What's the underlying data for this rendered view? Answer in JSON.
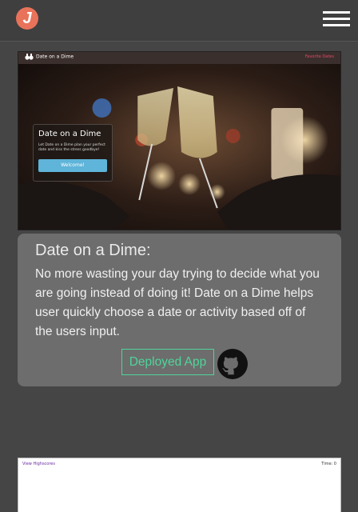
{
  "header": {
    "logo_letter": "J",
    "logo_color": "#e8735a"
  },
  "project": {
    "screenshot": {
      "nav_brand": "Date on a Dime",
      "nav_link": "Favorite Dates",
      "card_title": "Date on a Dime",
      "card_text": "Let Date on a Dime plan your perfect date and kiss the stress goodbye!",
      "card_button": "Welcome!"
    },
    "title": "Date on a Dime:",
    "description": "No more wasting your day trying to decide what you are going instead of doing it! Date on a Dime helps user quickly choose a date or activity based off of the users input.",
    "deploy_label": "Deployed App",
    "accent": "#4fd49b"
  },
  "next_project": {
    "left_text": "View Highscores",
    "right_text": "Time: 0"
  }
}
